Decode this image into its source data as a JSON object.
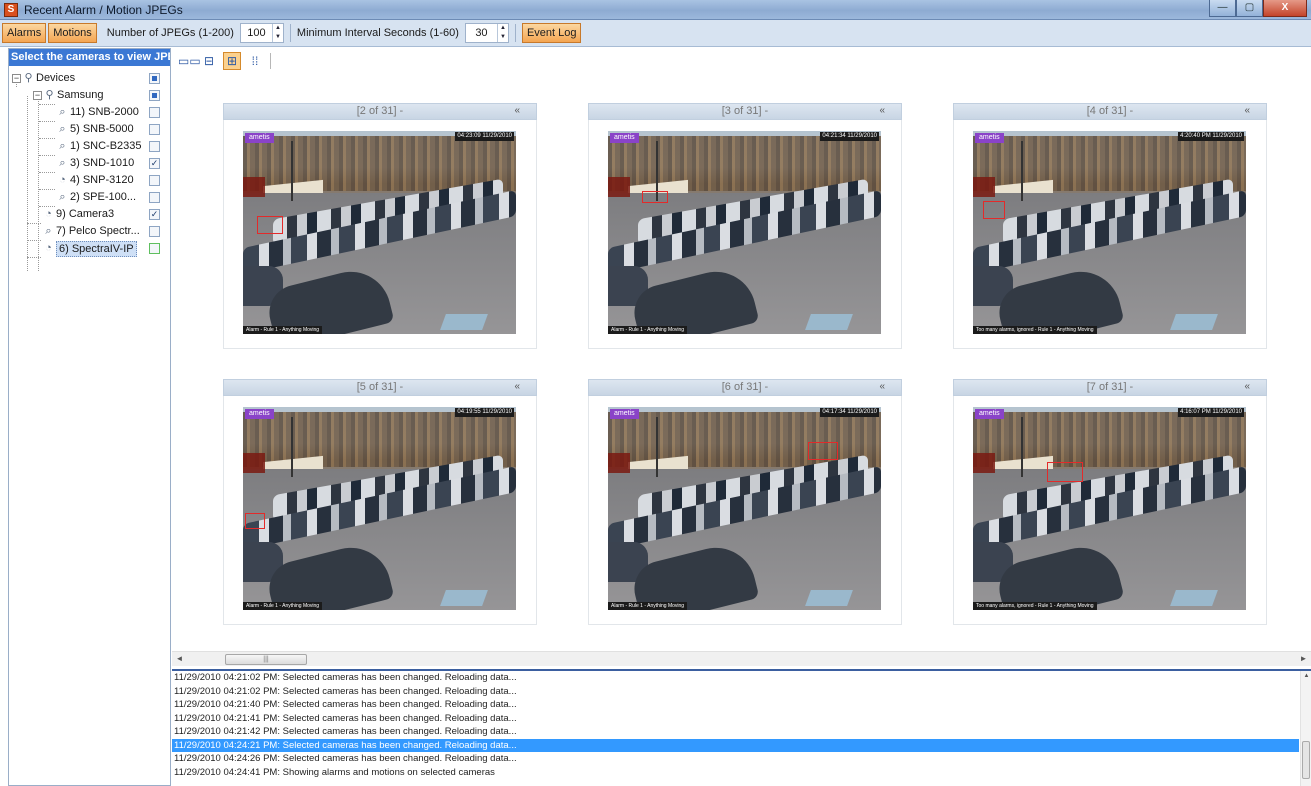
{
  "window": {
    "title": "Recent Alarm / Motion JPEGs",
    "app_icon_letter": "S",
    "minimize_glyph": "—",
    "maximize_glyph": "▢",
    "close_glyph": "X"
  },
  "toolbar": {
    "alarms_label": "Alarms",
    "motions_label": "Motions",
    "num_jpegs_label": "Number of JPEGs (1-200)",
    "num_jpegs_value": "100",
    "min_interval_label": "Minimum Interval Seconds (1-60)",
    "min_interval_value": "30",
    "event_log_label": "Event Log",
    "spin_up": "▲",
    "spin_down": "▼"
  },
  "camera_panel": {
    "header": "Select the cameras to view JPEGs",
    "tree": [
      {
        "label": "Devices",
        "checked": "partial"
      },
      {
        "label": "Samsung",
        "checked": "partial"
      },
      {
        "label": "11) SNB-2000",
        "checked": "no"
      },
      {
        "label": "5) SNB-5000",
        "checked": "no"
      },
      {
        "label": "1) SNC-B2335",
        "checked": "no"
      },
      {
        "label": "3) SND-1010",
        "checked": "yes"
      },
      {
        "label": "4) SNP-3120",
        "checked": "no"
      },
      {
        "label": "2) SPE-100...",
        "checked": "no"
      },
      {
        "label": "9) Camera3",
        "checked": "yes"
      },
      {
        "label": "7) Pelco Spectr...",
        "checked": "no"
      },
      {
        "label": "6) SpectraIV-IP",
        "checked": "no"
      }
    ],
    "expander_minus": "−",
    "check_glyph": "✓"
  },
  "view_buttons": {
    "single": "▭▭",
    "two": "⊟",
    "four": "⊞",
    "six": "⁞⁞"
  },
  "grid": {
    "collapse_glyph": "«",
    "cells": [
      {
        "caption": "[2 of 31] -",
        "brand": "ametis",
        "stamp": "04:23:09 11/29/2010",
        "footer": "Alarm - Rule 1 - Anything Moving"
      },
      {
        "caption": "[3 of 31] -",
        "brand": "ametis",
        "stamp": "04:21:34 11/29/2010",
        "footer": "Alarm - Rule 1 - Anything Moving"
      },
      {
        "caption": "[4 of 31] -",
        "brand": "ametis",
        "stamp": "4:20:40 PM 11/29/2010",
        "footer": "Too many alarms, ignored - Rule 1 - Anything Moving"
      },
      {
        "caption": "[5 of 31] -",
        "brand": "ametis",
        "stamp": "04:19:55 11/29/2010",
        "footer": "Alarm - Rule 1 - Anything Moving"
      },
      {
        "caption": "[6 of 31] -",
        "brand": "ametis",
        "stamp": "04:17:34 11/29/2010",
        "footer": "Alarm - Rule 1 - Anything Moving"
      },
      {
        "caption": "[7 of 31] -",
        "brand": "ametis",
        "stamp": "4:16:07 PM 11/29/2010",
        "footer": "Too many alarms, ignored - Rule 1 - Anything Moving"
      }
    ]
  },
  "hscroll": {
    "left_arrow": "◄",
    "right_arrow": "►",
    "thumb_grip": "|||"
  },
  "log": {
    "lines": [
      "11/29/2010 04:21:02 PM: Selected cameras has been changed. Reloading data...",
      "11/29/2010 04:21:02 PM: Selected cameras has been changed. Reloading data...",
      "11/29/2010 04:21:40 PM: Selected cameras has been changed. Reloading data...",
      "11/29/2010 04:21:41 PM: Selected cameras has been changed. Reloading data...",
      "11/29/2010 04:21:42 PM: Selected cameras has been changed. Reloading data...",
      "11/29/2010 04:24:21 PM: Selected cameras has been changed. Reloading data...",
      "11/29/2010 04:24:26 PM: Selected cameras has been changed. Reloading data...",
      "11/29/2010 04:24:41 PM: Showing alarms and motions on selected cameras"
    ],
    "selected_index": 5
  },
  "colors": {
    "accent_orange": "#f4a552",
    "selection_blue": "#3399ff",
    "panel_header_blue": "#3b78d4",
    "motion_box_red": "#e32a2a"
  }
}
